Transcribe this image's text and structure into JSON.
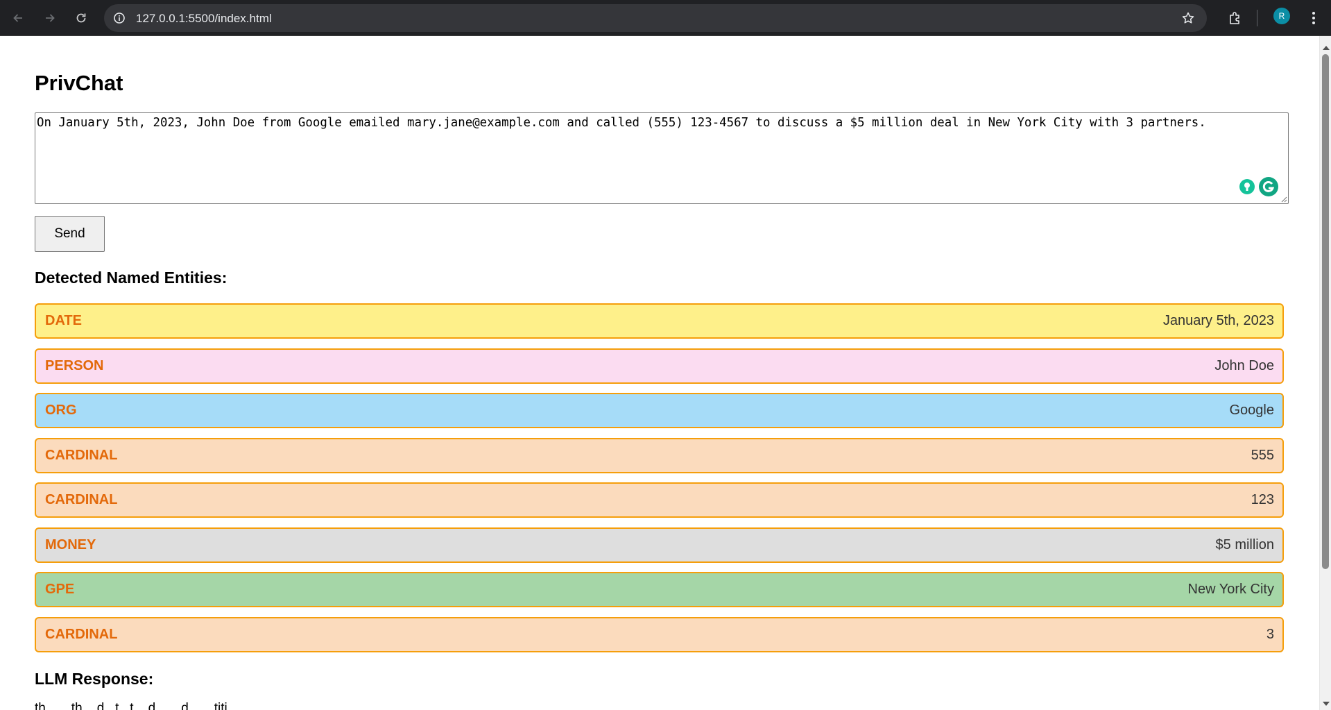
{
  "browser": {
    "url": "127.0.0.1:5500/index.html",
    "profile_initial": "R"
  },
  "app": {
    "title": "PrivChat",
    "message_value": "On January 5th, 2023, John Doe from Google emailed mary.jane@example.com and called (555) 123-4567 to discuss a $5 million deal in New York City with 3 partners.",
    "send_label": "Send",
    "entities_heading": "Detected Named Entities:",
    "llm_heading": "LLM Response:",
    "llm_response_partial": "th... ...th... d...t...t... d... ...d... ...titi..."
  },
  "entities": [
    {
      "label": "DATE",
      "value": "January 5th, 2023",
      "color": "#fef08a"
    },
    {
      "label": "PERSON",
      "value": "John Doe",
      "color": "#fbdcf1"
    },
    {
      "label": "ORG",
      "value": "Google",
      "color": "#a6dcf8"
    },
    {
      "label": "CARDINAL",
      "value": "555",
      "color": "#fbdbbd"
    },
    {
      "label": "CARDINAL",
      "value": "123",
      "color": "#fbdbbd"
    },
    {
      "label": "MONEY",
      "value": "$5 million",
      "color": "#dedede"
    },
    {
      "label": "GPE",
      "value": "New York City",
      "color": "#a5d6a7"
    },
    {
      "label": "CARDINAL",
      "value": "3",
      "color": "#fbdbbd"
    }
  ],
  "colors": {
    "entity_border": "#f59e0b",
    "entity_label_text": "#e3690a"
  },
  "icons": [
    "back-arrow-icon",
    "forward-arrow-icon",
    "reload-icon",
    "site-info-icon",
    "bookmark-star-icon",
    "extensions-icon",
    "kebab-menu-icon",
    "grammarly-suggestion-icon",
    "grammarly-g-icon"
  ]
}
